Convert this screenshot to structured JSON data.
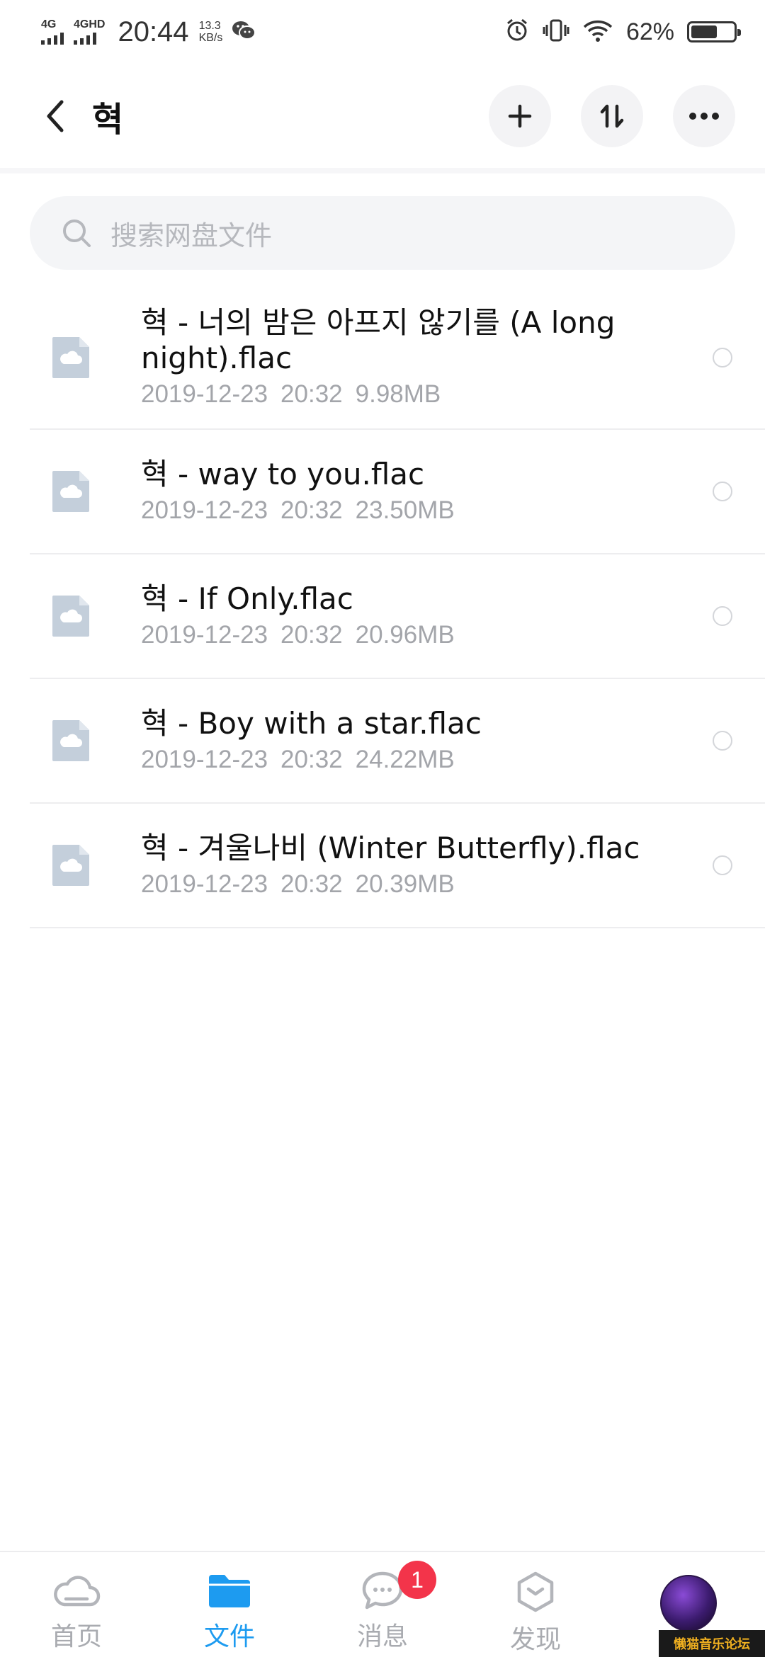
{
  "status_bar": {
    "signal1_label": "4G",
    "signal2_label": "4GHD",
    "time": "20:44",
    "speed_value": "13.3",
    "speed_unit": "KB/s",
    "battery_pct": "62%"
  },
  "header": {
    "title": "혁"
  },
  "search": {
    "placeholder": "搜索网盘文件"
  },
  "files": [
    {
      "name": "혁 - 너의 밤은 아프지 않기를 (A long night).flac",
      "date": "2019-12-23",
      "time": "20:32",
      "size": "9.98MB"
    },
    {
      "name": "혁 - way to you.flac",
      "date": "2019-12-23",
      "time": "20:32",
      "size": "23.50MB"
    },
    {
      "name": "혁 - If Only.flac",
      "date": "2019-12-23",
      "time": "20:32",
      "size": "20.96MB"
    },
    {
      "name": "혁 - Boy with a star.flac",
      "date": "2019-12-23",
      "time": "20:32",
      "size": "24.22MB"
    },
    {
      "name": "혁 - 겨울나비 (Winter Butterfly).flac",
      "date": "2019-12-23",
      "time": "20:32",
      "size": "20.39MB"
    }
  ],
  "bottom_nav": {
    "items": [
      {
        "label": "首页",
        "icon": "cloud-icon",
        "active": false
      },
      {
        "label": "文件",
        "icon": "folder-icon",
        "active": true
      },
      {
        "label": "消息",
        "icon": "message-icon",
        "active": false,
        "badge": "1"
      },
      {
        "label": "发现",
        "icon": "discover-icon",
        "active": false
      },
      {
        "label": "",
        "icon": "avatar",
        "active": false
      }
    ]
  },
  "watermark": "懒猫音乐论坛",
  "colors": {
    "accent": "#1d9bf0",
    "badge": "#f3344a",
    "meta_text": "#a3a5aa",
    "file_icon": "#c4cfdb"
  }
}
